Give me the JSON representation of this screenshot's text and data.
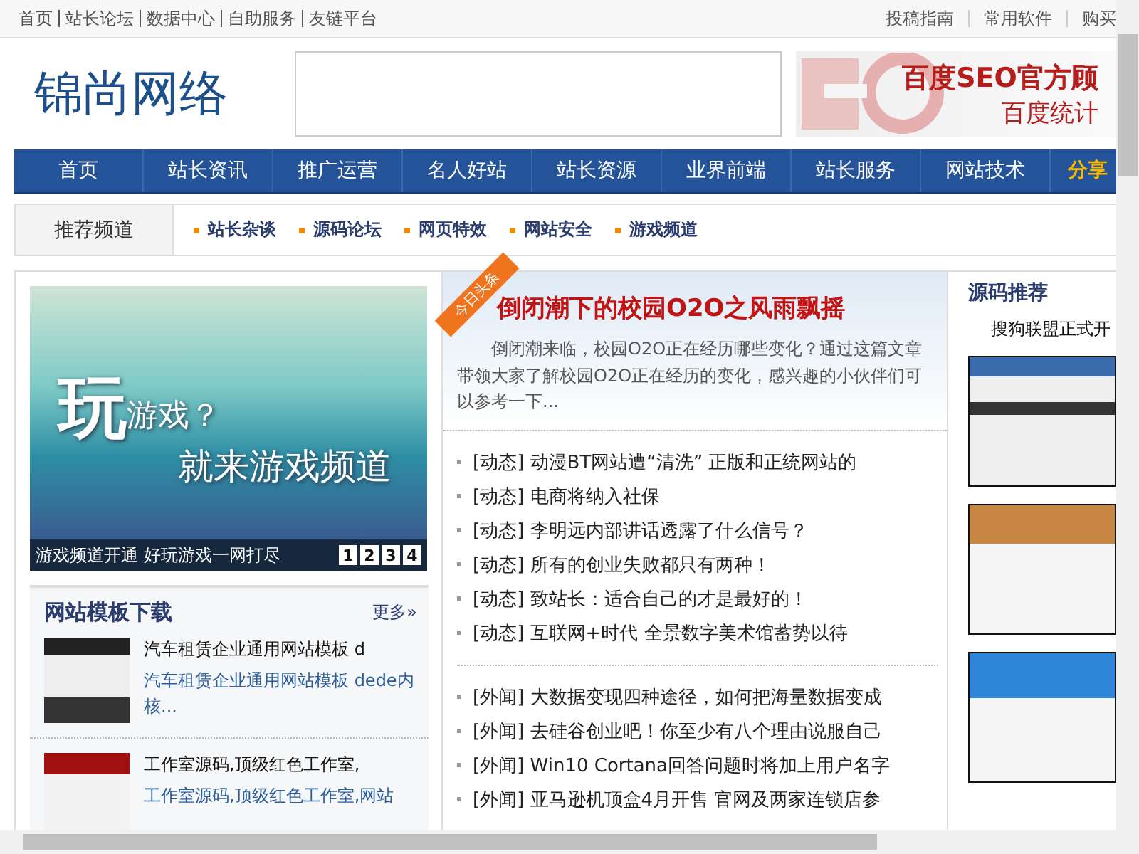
{
  "top_links": [
    "首页",
    "站长论坛",
    "数据中心",
    "自助服务",
    "友链平台"
  ],
  "top_right_links": [
    "投稿指南",
    "常用软件",
    "购买"
  ],
  "logo": "锦尚网络",
  "ad_banner": {
    "title": "百度SEO官方顾",
    "subtitle": "百度统计"
  },
  "nav": [
    {
      "label": "首页",
      "kind": "normal"
    },
    {
      "label": "站长资讯",
      "kind": "normal"
    },
    {
      "label": "推广运营",
      "kind": "normal"
    },
    {
      "label": "名人好站",
      "kind": "normal"
    },
    {
      "label": "站长资源",
      "kind": "normal"
    },
    {
      "label": "业界前端",
      "kind": "normal"
    },
    {
      "label": "站长服务",
      "kind": "normal"
    },
    {
      "label": "网站技术",
      "kind": "normal"
    },
    {
      "label": "分享",
      "kind": "hot"
    }
  ],
  "channels": {
    "title": "推荐频道",
    "items": [
      "站长杂谈",
      "源码论坛",
      "网页特效",
      "网站安全",
      "游戏频道"
    ]
  },
  "slideshow": {
    "big_char": "玩",
    "line1": "游戏？",
    "line2": "就来游戏频道",
    "caption": "游戏频道开通 好玩游戏一网打尽",
    "pages": [
      "1",
      "2",
      "3",
      "4"
    ]
  },
  "templates": {
    "title": "网站模板下载",
    "more": "更多»",
    "items": [
      {
        "title": "汽车租赁企业通用网站模板 d",
        "desc": "汽车租赁企业通用网站模板 dede内核..."
      },
      {
        "title": "工作室源码,顶级红色工作室,",
        "desc": "工作室源码,顶级红色工作室,网站"
      }
    ]
  },
  "headline": {
    "badge": "今日头条",
    "title": "倒闭潮下的校园O2O之风雨飘摇",
    "summary": "倒闭潮来临，校园O2O正在经历哪些变化？通过这篇文章带领大家了解校园O2O正在经历的变化，感兴趣的小伙伴们可以参考一下..."
  },
  "news_groups": [
    [
      {
        "tag": "[动态]",
        "title": "动漫BT网站遭“清洗” 正版和正统网站的"
      },
      {
        "tag": "[动态]",
        "title": "电商将纳入社保"
      },
      {
        "tag": "[动态]",
        "title": "李明远内部讲话透露了什么信号？"
      },
      {
        "tag": "[动态]",
        "title": "所有的创业失败都只有两种！"
      },
      {
        "tag": "[动态]",
        "title": "致站长：适合自己的才是最好的！"
      },
      {
        "tag": "[动态]",
        "title": "互联网+时代 全景数字美术馆蓄势以待"
      }
    ],
    [
      {
        "tag": "[外闻]",
        "title": "大数据变现四种途径，如何把海量数据变成"
      },
      {
        "tag": "[外闻]",
        "title": "去硅谷创业吧！你至少有八个理由说服自己"
      },
      {
        "tag": "[外闻]",
        "title": "Win10 Cortana回答问题时将加上用户名字"
      },
      {
        "tag": "[外闻]",
        "title": "亚马逊机顶盒4月开售 官网及两家连锁店参"
      }
    ]
  ],
  "source_recommend": {
    "title": "源码推荐",
    "featured": "搜狗联盟正式开"
  }
}
